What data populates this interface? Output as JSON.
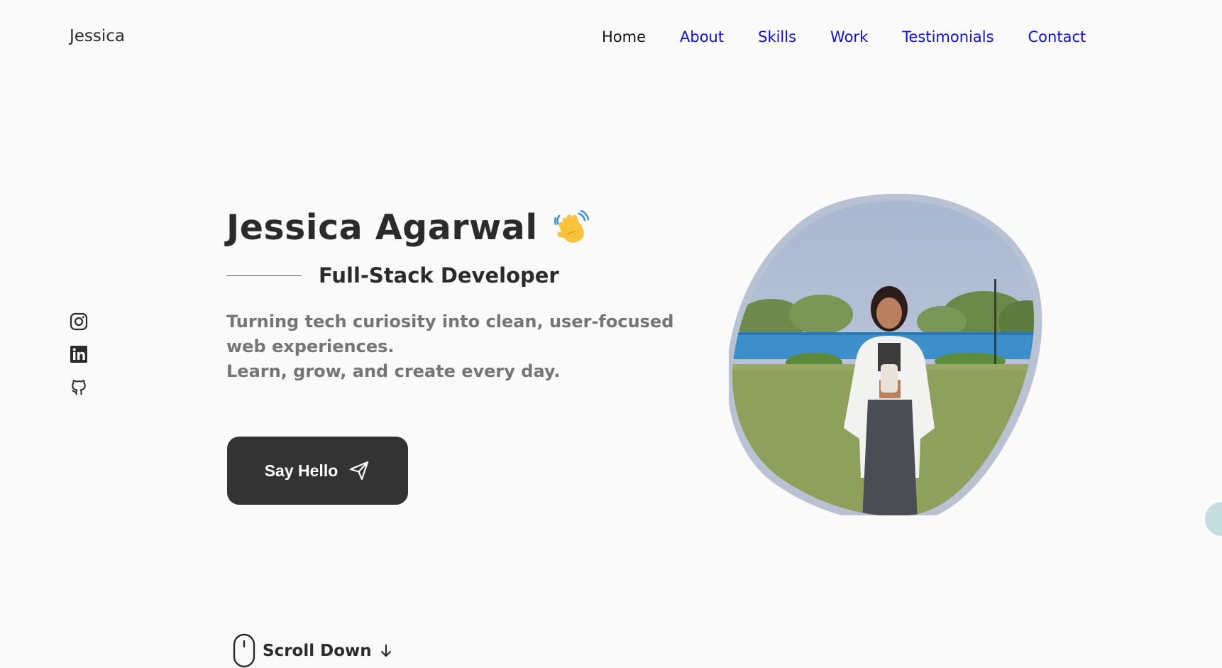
{
  "header": {
    "brand": "Jessica",
    "nav": [
      {
        "label": "Home",
        "active": true
      },
      {
        "label": "About",
        "active": false
      },
      {
        "label": "Skills",
        "active": false
      },
      {
        "label": "Work",
        "active": false
      },
      {
        "label": "Testimonials",
        "active": false
      },
      {
        "label": "Contact",
        "active": false
      }
    ]
  },
  "social": {
    "icons": [
      "instagram-icon",
      "linkedin-icon",
      "github-icon"
    ]
  },
  "hero": {
    "name": "Jessica Agarwal",
    "wave_icon": "waving-hand-icon",
    "subtitle": "Full-Stack Developer",
    "description_lines": [
      "Turning tech curiosity into clean, user-focused",
      "web experiences.",
      "Learn, grow, and create every day."
    ],
    "cta_label": "Say Hello",
    "cta_icon": "send-icon"
  },
  "scroll": {
    "label": "Scroll Down",
    "icons": [
      "mouse-icon",
      "arrow-down-icon"
    ]
  },
  "colors": {
    "nav_link": "#1010d8",
    "nav_active": "#111111",
    "text_dark": "#2b2b2b",
    "text_muted": "#757575",
    "button_bg": "#333333",
    "blob_ring": "#b9c2d2",
    "float_dot": "#c5dfe0"
  }
}
